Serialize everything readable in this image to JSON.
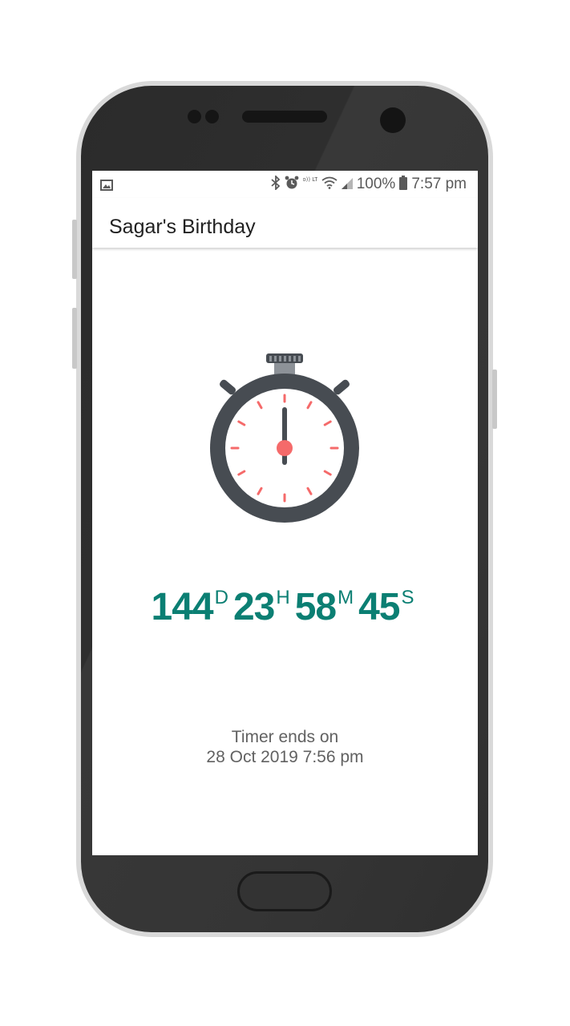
{
  "status_bar": {
    "left_icons": [
      "image-icon"
    ],
    "right_icons": [
      "bluetooth-icon",
      "alarm-icon",
      "volte-icon",
      "wifi-icon",
      "signal-icon"
    ],
    "volte_label": "Vo)) LTE",
    "battery_percent": "100%",
    "battery_level": 1.0,
    "time": "7:57 pm"
  },
  "app_bar": {
    "title": "Sagar's Birthday"
  },
  "stopwatch": {
    "icon": "stopwatch-icon",
    "colors": {
      "body": "#474c52",
      "face": "#ffffff",
      "ticks": "#f56a6a",
      "hand": "#474c52",
      "center": "#f56a6a",
      "crown": "#8d9298"
    }
  },
  "countdown": {
    "days": "144",
    "days_unit": "D",
    "hours": "23",
    "hours_unit": "H",
    "minutes": "58",
    "minutes_unit": "M",
    "seconds": "45",
    "seconds_unit": "S",
    "color": "#0b7f73"
  },
  "timer_end": {
    "label": "Timer ends on",
    "datetime": "28 Oct 2019 7:56 pm"
  }
}
